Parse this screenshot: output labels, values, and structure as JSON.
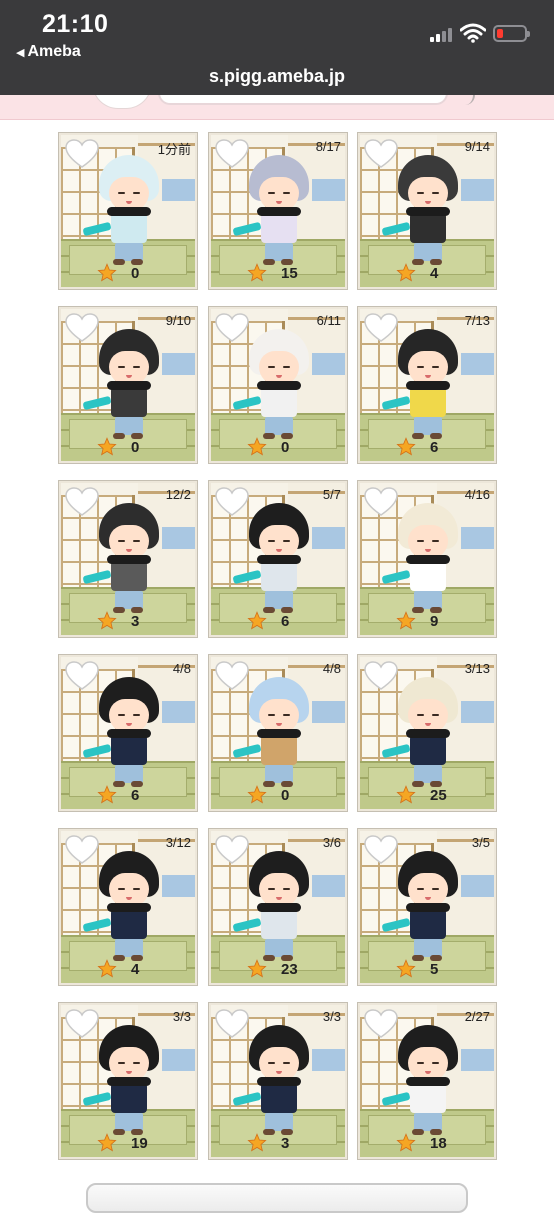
{
  "status_bar": {
    "time": "21:10",
    "back_app": "Ameba"
  },
  "browser": {
    "url": "s.pigg.ameba.jp"
  },
  "colors": {
    "star": "#f5a623",
    "heart": "#ffffff",
    "battery_low": "#ff3b30"
  },
  "cards": [
    {
      "date": "1分前",
      "count": "0",
      "hat": "#dceff4",
      "body": "#cfeaf0"
    },
    {
      "date": "8/17",
      "count": "15",
      "hat": "#b7bcd1",
      "body": "#e6e0f2"
    },
    {
      "date": "9/14",
      "count": "4",
      "hat": "#3a3a3a",
      "body": "#2f2f2f"
    },
    {
      "date": "9/10",
      "count": "0",
      "hat": "#2a2a2a",
      "body": "#3a3a3a"
    },
    {
      "date": "6/11",
      "count": "0",
      "hat": "#f3f1ee",
      "body": "#f1f1f1"
    },
    {
      "date": "7/13",
      "count": "6",
      "hat": "#262626",
      "body": "#f0d84a"
    },
    {
      "date": "12/2",
      "count": "3",
      "hat": "#2d2d2d",
      "body": "#5a5a5a"
    },
    {
      "date": "5/7",
      "count": "6",
      "hat": "#1e1e1e",
      "body": "#dfe6ec"
    },
    {
      "date": "4/16",
      "count": "9",
      "hat": "#f2ead6",
      "body": "#ffffff"
    },
    {
      "date": "4/8",
      "count": "6",
      "hat": "#1e1e1e",
      "body": "#1f2a44"
    },
    {
      "date": "4/8",
      "count": "0",
      "hat": "#b7d4ee",
      "body": "#d0a46a"
    },
    {
      "date": "3/13",
      "count": "25",
      "hat": "#efe8d2",
      "body": "#1f2a44"
    },
    {
      "date": "3/12",
      "count": "4",
      "hat": "#1e1e1e",
      "body": "#1f2a44"
    },
    {
      "date": "3/6",
      "count": "23",
      "hat": "#1e1e1e",
      "body": "#dfe6ec"
    },
    {
      "date": "3/5",
      "count": "5",
      "hat": "#1e1e1e",
      "body": "#1f2a44"
    },
    {
      "date": "3/3",
      "count": "19",
      "hat": "#1c1c1c",
      "body": "#1f2a44"
    },
    {
      "date": "3/3",
      "count": "3",
      "hat": "#1e1e1e",
      "body": "#1f2a44"
    },
    {
      "date": "2/27",
      "count": "18",
      "hat": "#1e1e1e",
      "body": "#f4f4f4"
    }
  ]
}
